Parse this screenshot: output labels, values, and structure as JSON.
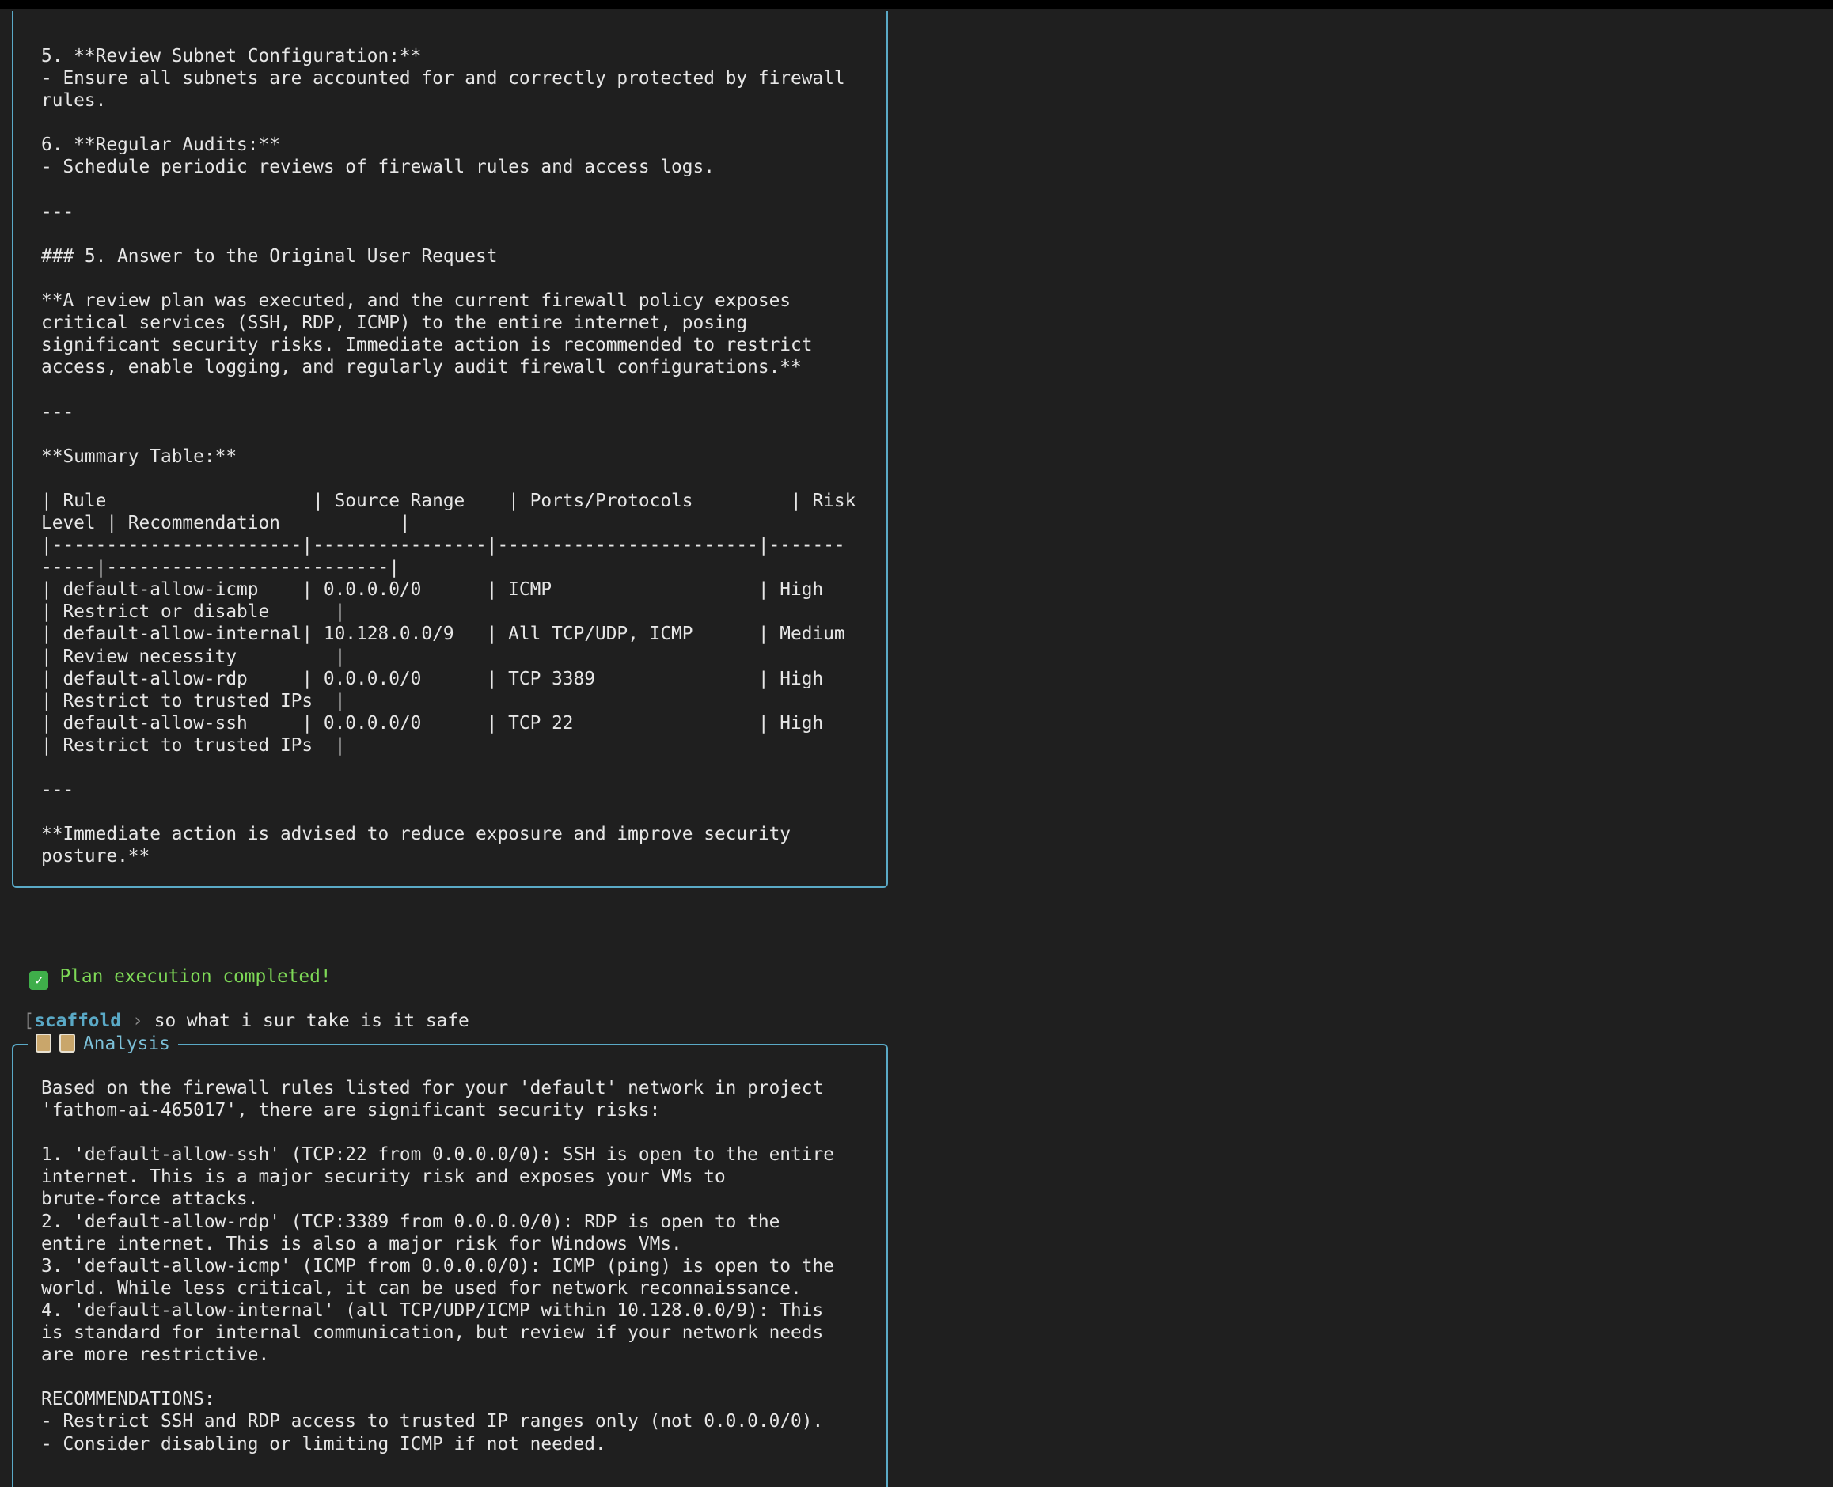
{
  "upper_panel": {
    "content": "5. **Review Subnet Configuration:**\n- Ensure all subnets are accounted for and correctly protected by firewall\nrules.\n\n6. **Regular Audits:**\n- Schedule periodic reviews of firewall rules and access logs.\n\n---\n\n### 5. Answer to the Original User Request\n\n**A review plan was executed, and the current firewall policy exposes\ncritical services (SSH, RDP, ICMP) to the entire internet, posing\nsignificant security risks. Immediate action is recommended to restrict\naccess, enable logging, and regularly audit firewall configurations.**\n\n---\n\n**Summary Table:**\n\n| Rule                   | Source Range    | Ports/Protocols         | Risk\nLevel | Recommendation           |\n|-----------------------|----------------|------------------------|-------\n-----|--------------------------|\n| default-allow-icmp    | 0.0.0.0/0      | ICMP                   | High\n| Restrict or disable      |\n| default-allow-internal| 10.128.0.0/9   | All TCP/UDP, ICMP      | Medium\n| Review necessity         |\n| default-allow-rdp     | 0.0.0.0/0      | TCP 3389               | High\n| Restrict to trusted IPs  |\n| default-allow-ssh     | 0.0.0.0/0      | TCP 22                 | High\n| Restrict to trusted IPs  |\n\n---\n\n**Immediate action is advised to reduce exposure and improve security\nposture.**"
  },
  "status": {
    "icon": "check-icon",
    "text": "Plan execution completed!",
    "color": "#7ed957"
  },
  "prompt": {
    "bracket": "[",
    "name": "scaffold",
    "arrow": "›",
    "input": "so what i sur take is it safe"
  },
  "analysis_panel": {
    "title": "Analysis",
    "icons": [
      "clipboard-icon",
      "clipboard-icon"
    ],
    "content": "Based on the firewall rules listed for your 'default' network in project\n'fathom-ai-465017', there are significant security risks:\n\n1. 'default-allow-ssh' (TCP:22 from 0.0.0.0/0): SSH is open to the entire\ninternet. This is a major security risk and exposes your VMs to\nbrute-force attacks.\n2. 'default-allow-rdp' (TCP:3389 from 0.0.0.0/0): RDP is open to the\nentire internet. This is also a major risk for Windows VMs.\n3. 'default-allow-icmp' (ICMP from 0.0.0.0/0): ICMP (ping) is open to the\nworld. While less critical, it can be used for network reconnaissance.\n4. 'default-allow-internal' (all TCP/UDP/ICMP within 10.128.0.0/9): This\nis standard for internal communication, but review if your network needs\nare more restrictive.\n\nRECOMMENDATIONS:\n- Restrict SSH and RDP access to trusted IP ranges only (not 0.0.0.0/0).\n- Consider disabling or limiting ICMP if not needed."
  },
  "colors": {
    "background": "#1f1f1f",
    "border": "#5aa9c6",
    "accent": "#7cc0d8"
  }
}
